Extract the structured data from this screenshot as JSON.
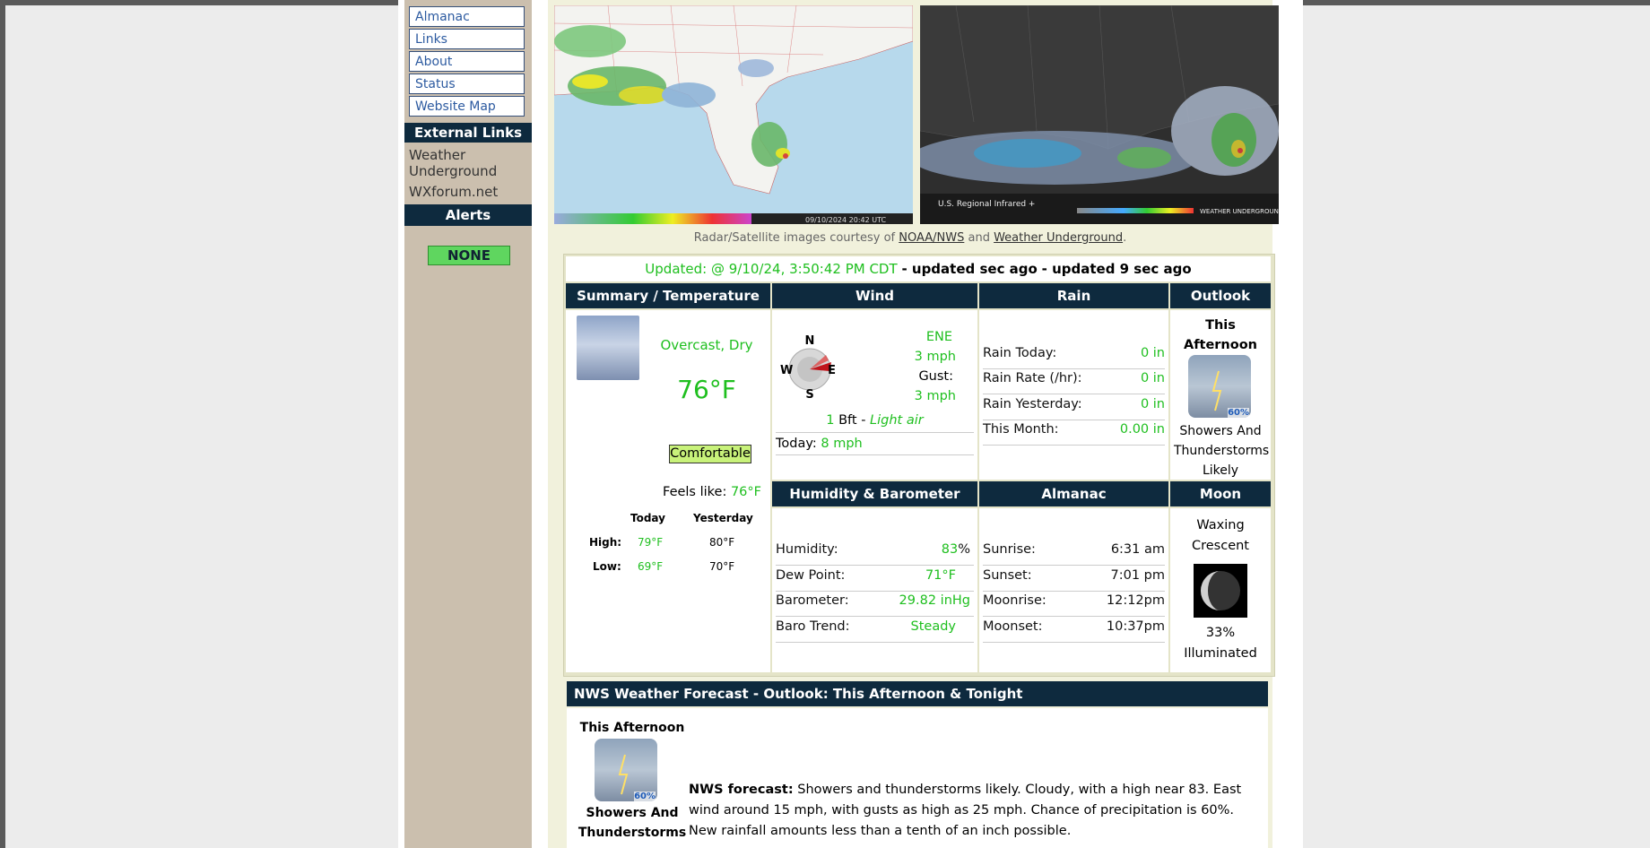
{
  "nav": {
    "items": [
      "Almanac",
      "Links",
      "About",
      "Status",
      "Website Map"
    ],
    "external_links_title": "External Links",
    "external_links": [
      "Weather Underground",
      "WXforum.net"
    ],
    "alerts_title": "Alerts",
    "alerts_value": "NONE"
  },
  "maps": {
    "radar_timestamp": "09/10/2024 20:42 UTC",
    "satellite_label": "U.S. Regional Infrared +",
    "satellite_brand": "WEATHER UNDERGROUND",
    "credit_prefix": "Radar/Satellite images courtesy of",
    "credit_link1": "NOAA/NWS",
    "credit_and": "and",
    "credit_link2": "Weather Underground",
    "credit_suffix": "."
  },
  "status": {
    "updated_label": "Updated: @",
    "updated_time": "9/10/24, 3:50:42 PM CDT",
    "ago1": "- updated  sec ago",
    "ago2": "- updated 9 sec ago"
  },
  "summary": {
    "heading": "Summary / Temperature",
    "condition": "Overcast, Dry",
    "temp": "76°F",
    "comfort": "Comfortable",
    "feels_label": "Feels like:",
    "feels_value": "76°F",
    "col_today": "Today",
    "col_yesterday": "Yesterday",
    "high_label": "High:",
    "high_today": "79°F",
    "high_yesterday": "80°F",
    "low_label": "Low:",
    "low_today": "69°F",
    "low_yesterday": "70°F"
  },
  "wind": {
    "heading": "Wind",
    "compass": {
      "n": "N",
      "s": "S",
      "e": "E",
      "w": "W"
    },
    "direction": "ENE",
    "speed": "3 mph",
    "gust_label": "Gust:",
    "gust": "3 mph",
    "bft_num": "1",
    "bft_unit": "Bft -",
    "bft_desc": "Light air",
    "today_label": "Today:",
    "today_value": "8 mph"
  },
  "rain": {
    "heading": "Rain",
    "rows": [
      {
        "label": "Rain Today:",
        "value": "0 in"
      },
      {
        "label": "Rain Rate (/hr):",
        "value": "0 in"
      },
      {
        "label": "Rain Yesterday:",
        "value": "0 in"
      },
      {
        "label": "This Month:",
        "value": "0.00 in"
      }
    ]
  },
  "outlook": {
    "heading": "Outlook",
    "period": "This Afternoon",
    "pop": "60%",
    "text": "Showers And Thunderstorms Likely"
  },
  "humidity": {
    "heading": "Humidity & Barometer",
    "humidity_label": "Humidity:",
    "humidity_value": "83",
    "humidity_unit": "%",
    "dew_label": "Dew Point:",
    "dew_value": "71°F",
    "baro_label": "Barometer:",
    "baro_value": "29.82 inHg",
    "trend_label": "Baro Trend:",
    "trend_value": "Steady"
  },
  "almanac": {
    "heading": "Almanac",
    "rows": [
      {
        "label": "Sunrise:",
        "value": "6:31 am"
      },
      {
        "label": "Sunset:",
        "value": "7:01 pm"
      },
      {
        "label": "Moonrise:",
        "value": "12:12pm"
      },
      {
        "label": "Moonset:",
        "value": "10:37pm"
      }
    ]
  },
  "moon": {
    "heading": "Moon",
    "phase": "Waxing Crescent",
    "illum": "33%",
    "illum_label": "Illuminated"
  },
  "forecast": {
    "heading": "NWS Weather Forecast  - Outlook: This Afternoon & Tonight",
    "period": "This Afternoon",
    "pop": "60%",
    "short": "Showers And Thunderstorms",
    "label": "NWS forecast:",
    "text": "Showers and thunderstorms likely. Cloudy, with a high near 83. East wind around 15 mph, with gusts as high as 25 mph. Chance of precipitation is 60%. New rainfall amounts less than a tenth of an inch possible."
  }
}
